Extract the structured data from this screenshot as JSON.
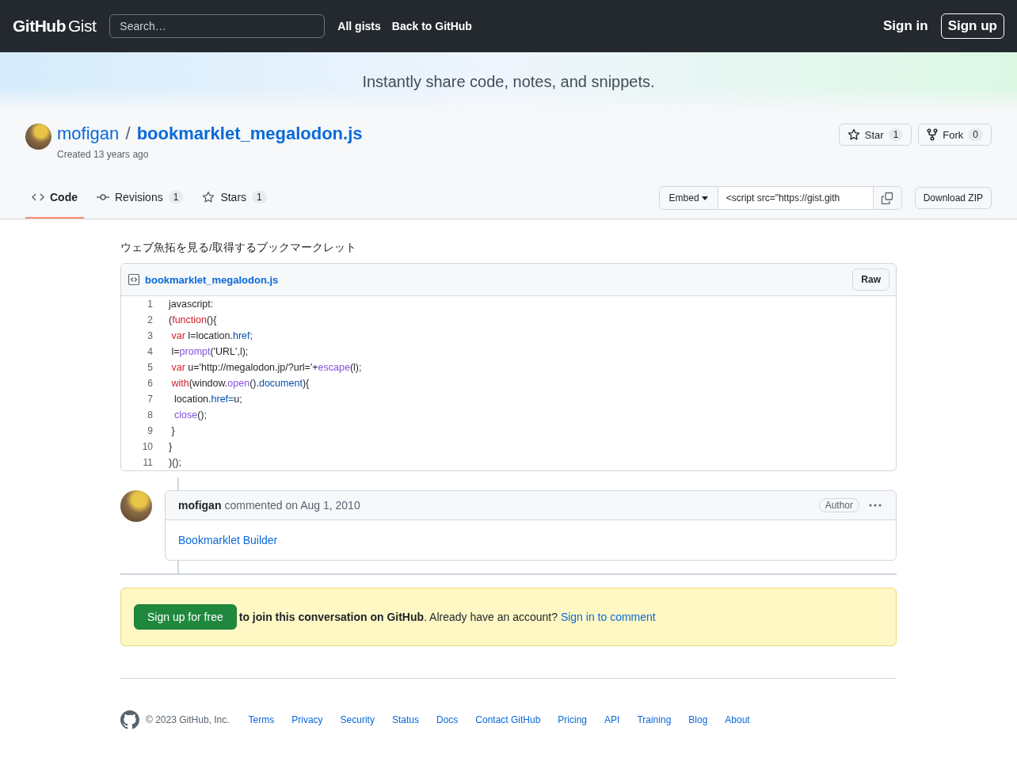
{
  "header": {
    "logo_bold": "GitHub",
    "logo_light": "Gist",
    "search": {
      "placeholder": "Search…"
    },
    "nav": [
      "All gists",
      "Back to GitHub"
    ],
    "sign_in": "Sign in",
    "sign_up": "Sign up"
  },
  "hero": {
    "tagline": "Instantly share code, notes, and snippets."
  },
  "gist": {
    "owner": "mofigan",
    "separator": "/",
    "name": "bookmarklet_megalodon.js",
    "created": "Created 13 years ago",
    "actions": [
      {
        "kind": "star",
        "label": "Star",
        "count": "1"
      },
      {
        "kind": "fork",
        "label": "Fork",
        "count": "0"
      }
    ],
    "tabs": [
      {
        "kind": "code",
        "label": "Code",
        "selected": true
      },
      {
        "kind": "revisions",
        "label": "Revisions",
        "count": "1",
        "selected": false
      },
      {
        "kind": "stars",
        "label": "Stars",
        "count": "1",
        "selected": false
      }
    ],
    "embed": {
      "label": "Embed",
      "value": "<script src=\"https://gist.gith"
    },
    "download": "Download ZIP"
  },
  "description": "ウェブ魚拓を見る/取得するブックマークレット",
  "file": {
    "name": "bookmarklet_megalodon.js",
    "raw": "Raw",
    "lines": [
      {
        "number": "1",
        "tokens": [
          {
            "kind": "plain",
            "text": "javascript:"
          }
        ]
      },
      {
        "number": "2",
        "tokens": [
          {
            "kind": "plain",
            "text": "("
          },
          {
            "kind": "keyword",
            "text": "function"
          },
          {
            "kind": "plain",
            "text": "(){"
          }
        ]
      },
      {
        "number": "3",
        "tokens": [
          {
            "kind": "keyword",
            "text": " var"
          },
          {
            "kind": "plain",
            "text": " l=location."
          },
          {
            "kind": "property",
            "text": "href"
          },
          {
            "kind": "plain",
            "text": ";"
          }
        ]
      },
      {
        "number": "4",
        "tokens": [
          {
            "kind": "plain",
            "text": " l="
          },
          {
            "kind": "function",
            "text": "prompt"
          },
          {
            "kind": "plain",
            "text": "('URL',l);"
          }
        ]
      },
      {
        "number": "5",
        "tokens": [
          {
            "kind": "keyword",
            "text": " var"
          },
          {
            "kind": "plain",
            "text": " u='http://megalodon.jp/?url='+"
          },
          {
            "kind": "function",
            "text": "escape"
          },
          {
            "kind": "plain",
            "text": "(l);"
          }
        ]
      },
      {
        "number": "6",
        "tokens": [
          {
            "kind": "keyword",
            "text": " with"
          },
          {
            "kind": "plain",
            "text": "(window."
          },
          {
            "kind": "function",
            "text": "open"
          },
          {
            "kind": "plain",
            "text": "()."
          },
          {
            "kind": "property",
            "text": "document"
          },
          {
            "kind": "plain",
            "text": "){"
          }
        ]
      },
      {
        "number": "7",
        "tokens": [
          {
            "kind": "plain",
            "text": "  location."
          },
          {
            "kind": "property",
            "text": "href="
          },
          {
            "kind": "plain",
            "text": "u;"
          }
        ]
      },
      {
        "number": "8",
        "tokens": [
          {
            "kind": "function",
            "text": "  close"
          },
          {
            "kind": "plain",
            "text": "();"
          }
        ]
      },
      {
        "number": "9",
        "tokens": [
          {
            "kind": "plain",
            "text": " }"
          }
        ]
      },
      {
        "number": "10",
        "tokens": [
          {
            "kind": "plain",
            "text": "}"
          }
        ]
      },
      {
        "number": "11",
        "tokens": [
          {
            "kind": "plain",
            "text": ")();"
          }
        ]
      }
    ]
  },
  "comment": {
    "author": "mofigan",
    "meta": "commented on Aug 1, 2010",
    "badge": "Author",
    "link": "Bookmarklet Builder"
  },
  "signup_banner": {
    "button": "Sign up for free",
    "bold": "to join this conversation on GitHub",
    "text": ". Already have an account?",
    "link": "Sign in to comment"
  },
  "footer": {
    "copyright": "© 2023 GitHub, Inc.",
    "links": [
      "Terms",
      "Privacy",
      "Security",
      "Status",
      "Docs",
      "Contact GitHub",
      "Pricing",
      "API",
      "Training",
      "Blog",
      "About"
    ]
  }
}
